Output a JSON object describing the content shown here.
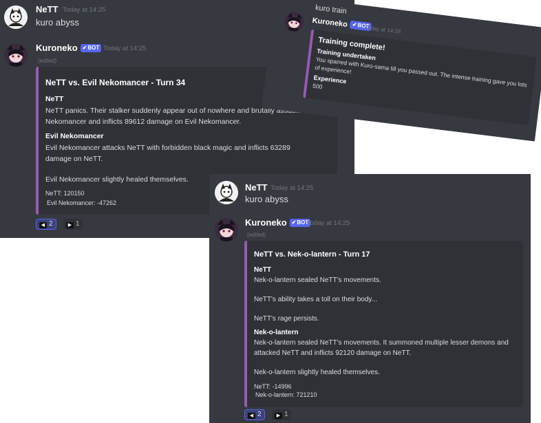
{
  "panel_a": {
    "msg1": {
      "author": "NeTT",
      "time": "Today at 14:25",
      "text": "kuro abyss"
    },
    "msg2": {
      "author": "Kuroneko",
      "badge": "BOT",
      "time": "Today at 14:25",
      "edited": "(edited)",
      "embed": {
        "title": "NeTT vs. Evil Nekomancer - Turn 34",
        "field1_name": "NeTT",
        "field1_line1": "NeTT panics. Their stalker suddenly appear out of nowhere and brutally assault Evil",
        "field1_line2": "Nekomancer and inflicts 89612 damage on Evil Nekomancer.",
        "field2_name": "Evil Nekomancer",
        "field2_line1": "Evil Nekomancer attacks NeTT with forbidden black magic and inflicts 63289",
        "field2_line2": "damage on NeTT.",
        "field2_line3": "Evil Nekomancer slightly healed themselves.",
        "hp1": "NeTT: 120150",
        "hp2": "Evil Nekomancer: -47262"
      },
      "reactions": [
        {
          "count": "2"
        },
        {
          "count": "1"
        }
      ]
    }
  },
  "panel_b": {
    "msg1": {
      "author": "NeTT",
      "time": "Today at 14:25",
      "text": "kuro abyss"
    },
    "msg2": {
      "author": "Kuroneko",
      "badge": "BOT",
      "time": "Today at 14:25",
      "edited": "(edited)",
      "embed": {
        "title": "NeTT vs. Nek-o-lantern - Turn 17",
        "field1_name": "NeTT",
        "field1_line1": "Nek-o-lantern sealed NeTT's movements.",
        "field1_line2": "NeTT's ability takes a toll on their body...",
        "field1_line3": "NeTT's rage persists.",
        "field2_name": "Nek-o-lantern",
        "field2_line1": "Nek-o-lantern sealed NeTT's movements. It summoned multiple lesser demons and",
        "field2_line2": "attacked NeTT and inflicts 92120 damage on NeTT.",
        "field2_line3": "Nek-o-lantern slightly healed themselves.",
        "hp1": "NeTT: -14996",
        "hp2": "Nek-o-lantern: 721210"
      },
      "reactions": [
        {
          "count": "2"
        },
        {
          "count": "1"
        }
      ]
    }
  },
  "panel_c": {
    "prev_text": "kuro train",
    "msg": {
      "author": "Kuroneko",
      "badge": "BOT",
      "time": "Today at 14:26",
      "embed": {
        "title": "Training complete!",
        "field1_name": "Training undertaken",
        "field1_line1": "You sparred with Kuro-sama till you passed out. The intense training gave you lots",
        "field1_line2": "of experience!",
        "field2_name": "Experience",
        "field2_value": "500"
      }
    }
  },
  "colors": {
    "bg": "#36393f",
    "embed_bg": "#2f3136",
    "accent": "#9b59b6",
    "badge": "#5865f2",
    "muted": "#72767d"
  },
  "icons": {
    "bot_verified": "check-icon",
    "reaction_1": "left-arrow-emoji-icon",
    "reaction_2": "right-arrow-emoji-icon"
  }
}
